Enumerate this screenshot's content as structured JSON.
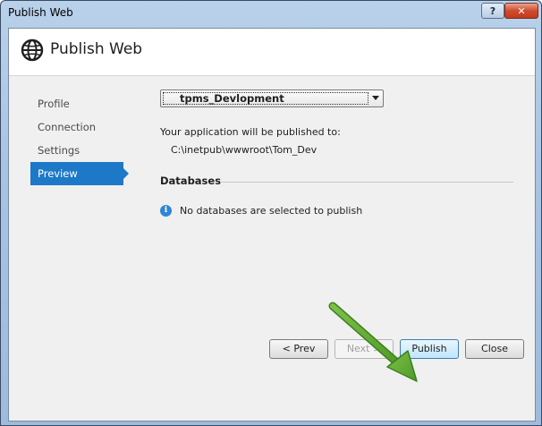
{
  "window": {
    "title": "Publish Web",
    "help_glyph": "?",
    "close_glyph": "✕"
  },
  "header": {
    "title": "Publish Web",
    "icon": "globe-icon"
  },
  "nav": {
    "items": [
      {
        "label": "Profile"
      },
      {
        "label": "Connection"
      },
      {
        "label": "Settings"
      },
      {
        "label": "Preview",
        "active": true
      }
    ]
  },
  "preview": {
    "profile_selected": "tpms_Devlopment",
    "published_to_label": "Your application will be published to:",
    "published_path": "C:\\inetpub\\wwwroot\\Tom_Dev",
    "databases_header": "Databases",
    "databases_message": "No databases are selected to publish",
    "info_glyph": "i"
  },
  "buttons": {
    "prev": "< Prev",
    "next": "Next >",
    "publish": "Publish",
    "close": "Close"
  },
  "colors": {
    "accent": "#1e78c8",
    "annotation_arrow": "#5aa02c"
  }
}
